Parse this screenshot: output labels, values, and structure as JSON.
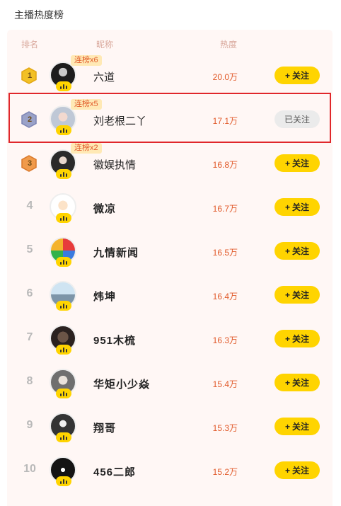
{
  "page_title": "主播热度榜",
  "columns": {
    "rank": "排名",
    "nickname": "昵称",
    "heat": "热度"
  },
  "colors": {
    "accent": "#ffd400",
    "heat": "#e15a2a",
    "gold": "#f2c025",
    "silver": "#9aa2c8",
    "bronze": "#f09a4a",
    "highlight": "#e0272b"
  },
  "rows": [
    {
      "rank": "1",
      "name": "六道",
      "heat": "20.0万",
      "streak": "连榜x6",
      "button": "关注",
      "followed": false,
      "badge": "gold-medal-icon"
    },
    {
      "rank": "2",
      "name": "刘老根二丫",
      "heat": "17.1万",
      "streak": "连榜x5",
      "button": "已关注",
      "followed": true,
      "badge": "silver-medal-icon"
    },
    {
      "rank": "3",
      "name": "徽娱执情",
      "heat": "16.8万",
      "streak": "连榜x2",
      "button": "关注",
      "followed": false,
      "badge": "bronze-medal-icon"
    },
    {
      "rank": "4",
      "name": "微凉",
      "heat": "16.7万",
      "button": "关注",
      "followed": false
    },
    {
      "rank": "5",
      "name": "九情新闻",
      "heat": "16.5万",
      "button": "关注",
      "followed": false
    },
    {
      "rank": "6",
      "name": "炜坤",
      "heat": "16.4万",
      "button": "关注",
      "followed": false
    },
    {
      "rank": "7",
      "name": "951木梳",
      "heat": "16.3万",
      "button": "关注",
      "followed": false
    },
    {
      "rank": "8",
      "name": "华矩小少焱",
      "heat": "15.4万",
      "button": "关注",
      "followed": false
    },
    {
      "rank": "9",
      "name": "翔哥",
      "heat": "15.3万",
      "button": "关注",
      "followed": false
    },
    {
      "rank": "10",
      "name": "456二郎",
      "heat": "15.2万",
      "button": "关注",
      "followed": false
    }
  ]
}
